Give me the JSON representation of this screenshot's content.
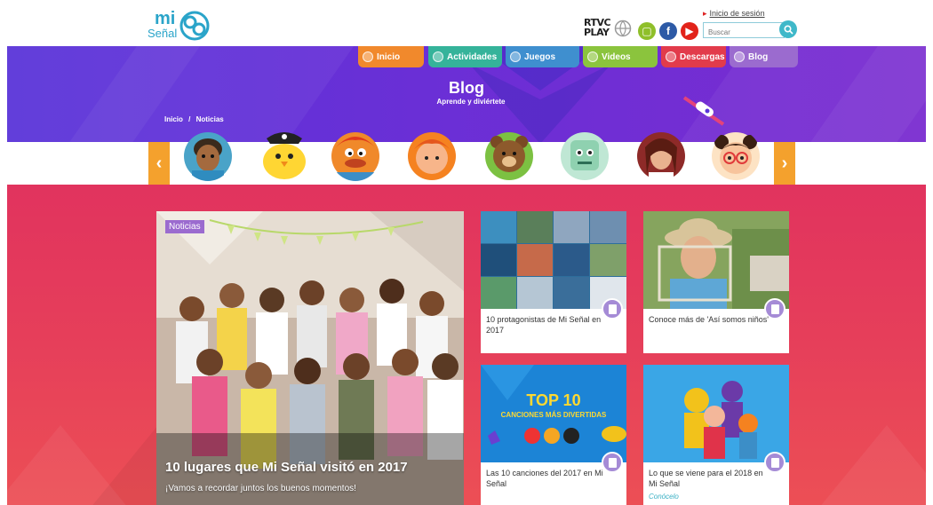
{
  "header": {
    "logo_mi": "mi",
    "logo_senal": "Señal",
    "rtvc_line1": "RTVC",
    "rtvc_line2": "PLAY",
    "login_label": "Inicio de sesión",
    "search_placeholder": "Buscar",
    "social": [
      "tv-icon",
      "facebook-icon",
      "youtube-icon"
    ]
  },
  "nav": {
    "tabs": [
      {
        "label": "Inicio",
        "color": "#f1892c"
      },
      {
        "label": "Actividades",
        "color": "#35b39a"
      },
      {
        "label": "Juegos",
        "color": "#3f8fcf"
      },
      {
        "label": "Videos",
        "color": "#8bc43d"
      },
      {
        "label": "Descargas",
        "color": "#e23b4b"
      },
      {
        "label": "Blog",
        "color": "#9b6bcf"
      }
    ]
  },
  "banner": {
    "title": "Blog",
    "subtitle": "Aprende y diviértete",
    "breadcrumb_home": "Inicio",
    "breadcrumb_sep": "/",
    "breadcrumb_current": "Noticias"
  },
  "carousel": {
    "prev": "‹",
    "next": "›"
  },
  "feature": {
    "badge": "Noticias",
    "title": "10 lugares que Mi Señal visitó en 2017",
    "subtitle": "¡Vamos a recordar juntos los buenos momentos!"
  },
  "cards": [
    {
      "caption": "10 protagonistas de Mi Señal en 2017",
      "sub": ""
    },
    {
      "caption": "Conoce más de 'Así somos niños'",
      "sub": ""
    },
    {
      "caption": "Las 10 canciones del 2017 en Mi Señal",
      "sub": "",
      "img_title": "TOP 10",
      "img_sub": "CANCIONES MÁS DIVERTIDAS"
    },
    {
      "caption": "Lo que se viene para el 2018 en Mi Señal",
      "sub": "Conócelo"
    }
  ],
  "colors": {
    "banner": "#5a34d9",
    "body": "#e1335e",
    "accent": "#f4a12d"
  }
}
